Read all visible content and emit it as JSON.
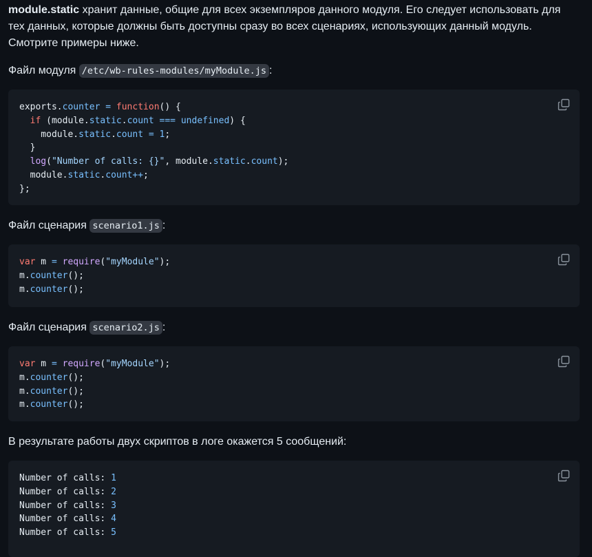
{
  "intro": {
    "bold": "module.static",
    "text": " хранит данные, общие для всех экземпляров данного модуля. Его следует использовать для тех данных, которые должны быть доступны сразу во всех сценариях, использующих данный модуль. Смотрите примеры ниже."
  },
  "module_file": {
    "label": "Файл модуля ",
    "path": "/etc/wb-rules-modules/myModule.js",
    "suffix": ":"
  },
  "scenario1_file": {
    "label": "Файл сценария ",
    "path": "scenario1.js",
    "suffix": ":"
  },
  "scenario2_file": {
    "label": "Файл сценария ",
    "path": "scenario2.js",
    "suffix": ":"
  },
  "result_text": "В результате работы двух скриптов в логе окажется 5 сообщений:",
  "code": {
    "module_tokens": [
      [
        "exports.",
        ""
      ],
      [
        "counter",
        "prop"
      ],
      [
        " = ",
        "prop"
      ],
      [
        "function",
        "kw"
      ],
      [
        "() {\n  ",
        ""
      ],
      [
        "if",
        "kw"
      ],
      [
        " (module.",
        ""
      ],
      [
        "static",
        "prop"
      ],
      [
        ".",
        ""
      ],
      [
        "count",
        "prop"
      ],
      [
        " === ",
        "prop"
      ],
      [
        "undefined",
        "prop"
      ],
      [
        ") {\n    module.",
        ""
      ],
      [
        "static",
        "prop"
      ],
      [
        ".",
        ""
      ],
      [
        "count",
        "prop"
      ],
      [
        " = ",
        "prop"
      ],
      [
        "1",
        "num"
      ],
      [
        ";\n  }\n  ",
        ""
      ],
      [
        "log",
        "fn"
      ],
      [
        "(",
        ""
      ],
      [
        "\"Number of calls: {}\"",
        "str"
      ],
      [
        ", module.",
        ""
      ],
      [
        "static",
        "prop"
      ],
      [
        ".",
        ""
      ],
      [
        "count",
        "prop"
      ],
      [
        ");\n  module.",
        ""
      ],
      [
        "static",
        "prop"
      ],
      [
        ".",
        ""
      ],
      [
        "count",
        "prop"
      ],
      [
        "++",
        "prop"
      ],
      [
        ";\n};",
        ""
      ]
    ],
    "scenario1_tokens": [
      [
        "var",
        "kw"
      ],
      [
        " m ",
        ""
      ],
      [
        "=",
        "prop"
      ],
      [
        " ",
        ""
      ],
      [
        "require",
        "fn"
      ],
      [
        "(",
        ""
      ],
      [
        "\"myModule\"",
        "str"
      ],
      [
        ");\nm.",
        ""
      ],
      [
        "counter",
        "prop"
      ],
      [
        "();\nm.",
        ""
      ],
      [
        "counter",
        "prop"
      ],
      [
        "();",
        ""
      ]
    ],
    "scenario2_tokens": [
      [
        "var",
        "kw"
      ],
      [
        " m ",
        ""
      ],
      [
        "=",
        "prop"
      ],
      [
        " ",
        ""
      ],
      [
        "require",
        "fn"
      ],
      [
        "(",
        ""
      ],
      [
        "\"myModule\"",
        "str"
      ],
      [
        ");\nm.",
        ""
      ],
      [
        "counter",
        "prop"
      ],
      [
        "();\nm.",
        ""
      ],
      [
        "counter",
        "prop"
      ],
      [
        "();\nm.",
        ""
      ],
      [
        "counter",
        "prop"
      ],
      [
        "();",
        ""
      ]
    ],
    "log_tokens": [
      [
        "Number of calls: ",
        ""
      ],
      [
        "1",
        "num"
      ],
      [
        "\nNumber of calls: ",
        ""
      ],
      [
        "2",
        "num"
      ],
      [
        "\nNumber of calls: ",
        ""
      ],
      [
        "3",
        "num"
      ],
      [
        "\nNumber of calls: ",
        ""
      ],
      [
        "4",
        "num"
      ],
      [
        "\nNumber of calls: ",
        ""
      ],
      [
        "5",
        "num"
      ]
    ]
  },
  "icons": {
    "copy": "copy-icon"
  }
}
